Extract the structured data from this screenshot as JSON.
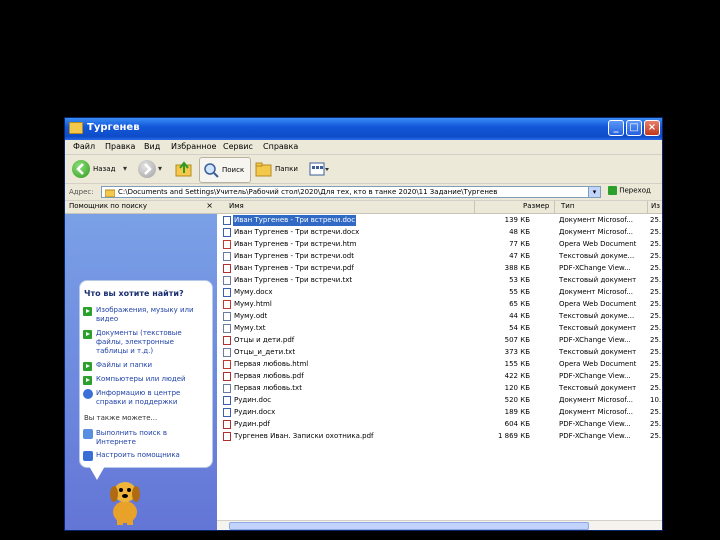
{
  "window": {
    "title": "Тургенев"
  },
  "menu": [
    "Файл",
    "Правка",
    "Вид",
    "Избранное",
    "Сервис",
    "Справка"
  ],
  "toolbar": {
    "back": "Назад",
    "search": "Поиск",
    "folders": "Папки"
  },
  "address": {
    "label": "Адрес:",
    "path": "C:\\Documents and Settings\\Учитель\\Рабочий стол\\2020\\Для тех, кто в танке 2020\\11 Задание\\Тургенев",
    "go": "Переход"
  },
  "taskpane": {
    "header": "Помощник по поиску",
    "close": "×",
    "question": "Что вы хотите найти?",
    "items": [
      "Изображения, музыку или видео",
      "Документы (текстовые файлы, электронные таблицы и т.д.)",
      "Файлы и папки",
      "Компьютеры или людей",
      "Информацию в центре справки и поддержки"
    ],
    "also": "Вы также можете...",
    "extra": [
      "Выполнить поиск в Интернете",
      "Настроить помощника"
    ]
  },
  "columns": {
    "name": "Имя",
    "size": "Размер",
    "type": "Тип",
    "modified": "Из"
  },
  "files": [
    {
      "name": "Иван Тургенев - Три встречи.doc",
      "size": "139 КБ",
      "type": "Документ Microsof...",
      "mod": "25."
    },
    {
      "name": "Иван Тургенев - Три встречи.docx",
      "size": "48 КБ",
      "type": "Документ Microsof...",
      "mod": "25."
    },
    {
      "name": "Иван Тургенев - Три встречи.htm",
      "size": "77 КБ",
      "type": "Opera Web Document",
      "mod": "25."
    },
    {
      "name": "Иван Тургенев - Три встречи.odt",
      "size": "47 КБ",
      "type": "Текстовый докуме...",
      "mod": "25."
    },
    {
      "name": "Иван Тургенев - Три встречи.pdf",
      "size": "388 КБ",
      "type": "PDF-XChange View...",
      "mod": "25."
    },
    {
      "name": "Иван Тургенев - Три встречи.txt",
      "size": "53 КБ",
      "type": "Текстовый документ",
      "mod": "25."
    },
    {
      "name": "Муму.docx",
      "size": "55 КБ",
      "type": "Документ Microsof...",
      "mod": "25."
    },
    {
      "name": "Муму.html",
      "size": "65 КБ",
      "type": "Opera Web Document",
      "mod": "25."
    },
    {
      "name": "Муму.odt",
      "size": "44 КБ",
      "type": "Текстовый докуме...",
      "mod": "25."
    },
    {
      "name": "Муму.txt",
      "size": "54 КБ",
      "type": "Текстовый документ",
      "mod": "25."
    },
    {
      "name": "Отцы и дети.pdf",
      "size": "507 КБ",
      "type": "PDF-XChange View...",
      "mod": "25."
    },
    {
      "name": "Отцы_и_дети.txt",
      "size": "373 КБ",
      "type": "Текстовый документ",
      "mod": "25."
    },
    {
      "name": "Первая любовь.html",
      "size": "155 КБ",
      "type": "Opera Web Document",
      "mod": "25."
    },
    {
      "name": "Первая любовь.pdf",
      "size": "422 КБ",
      "type": "PDF-XChange View...",
      "mod": "25."
    },
    {
      "name": "Первая любовь.txt",
      "size": "120 КБ",
      "type": "Текстовый документ",
      "mod": "25."
    },
    {
      "name": "Рудин.doc",
      "size": "520 КБ",
      "type": "Документ Microsof...",
      "mod": "10."
    },
    {
      "name": "Рудин.docx",
      "size": "189 КБ",
      "type": "Документ Microsof...",
      "mod": "25."
    },
    {
      "name": "Рудин.pdf",
      "size": "604 КБ",
      "type": "PDF-XChange View...",
      "mod": "25."
    },
    {
      "name": "Тургенев Иван. Записки охотника.pdf",
      "size": "1 869 КБ",
      "type": "PDF-XChange View...",
      "mod": "25."
    }
  ],
  "colors": {
    "title_bar": "#0e4cc8",
    "task_pane": "#7ba2e7",
    "selection": "#316ac5"
  }
}
